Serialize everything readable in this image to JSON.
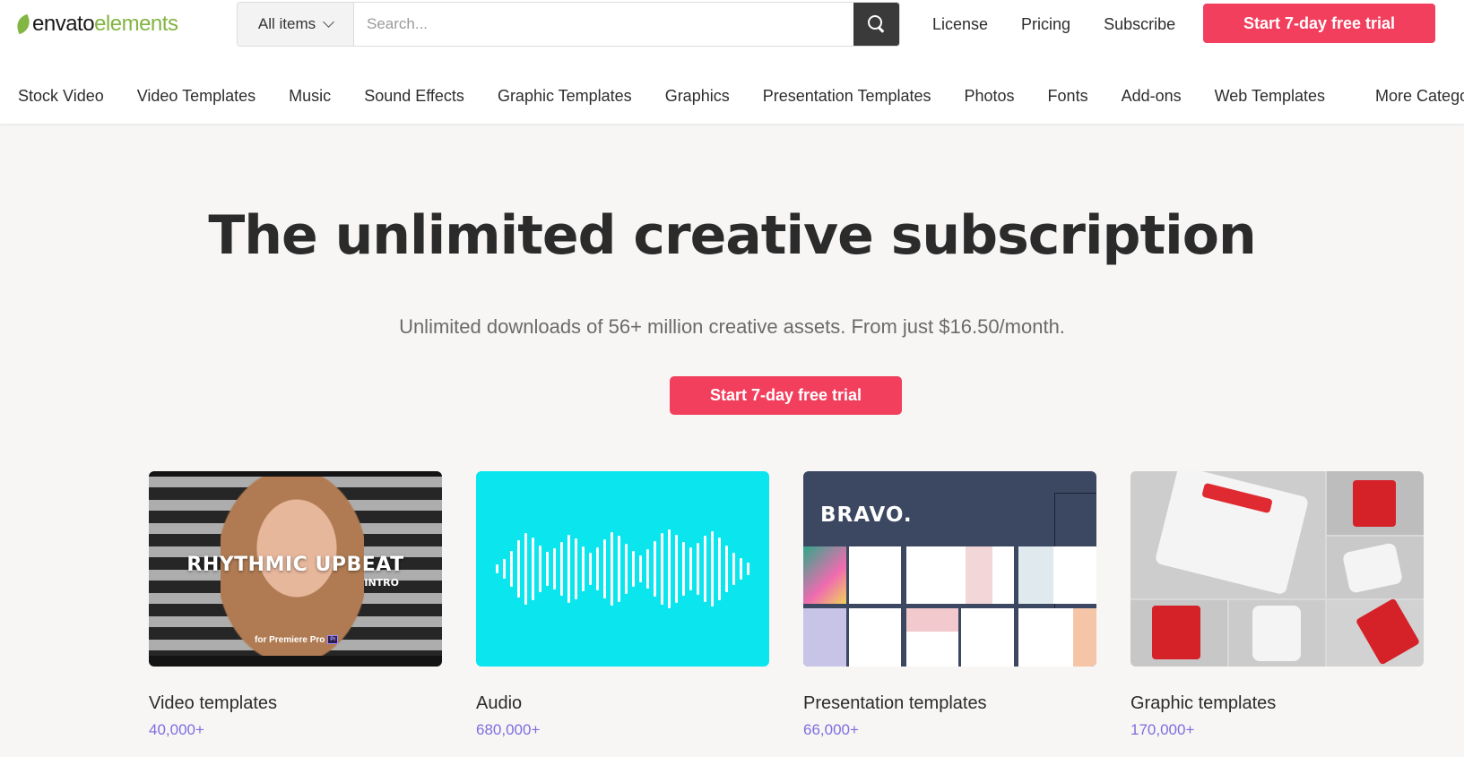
{
  "brand": {
    "part1": "envato",
    "part2": "elements"
  },
  "search": {
    "category": "All items",
    "placeholder": "Search..."
  },
  "header_links": [
    "License",
    "Pricing",
    "Subscribe"
  ],
  "header_cta": "Start 7-day free trial",
  "categories": [
    "Stock Video",
    "Video Templates",
    "Music",
    "Sound Effects",
    "Graphic Templates",
    "Graphics",
    "Presentation Templates",
    "Photos",
    "Fonts",
    "Add-ons",
    "Web Templates"
  ],
  "more_categories": "More Categori",
  "hero": {
    "title": "The unlimited creative subscription",
    "subtitle": "Unlimited downloads of 56+ million creative assets. From just $16.50/month.",
    "cta": "Start 7-day free trial"
  },
  "cards": [
    {
      "title": "Video templates",
      "count": "40,000+",
      "thumb_title": "RHYTHMIC UPBEAT",
      "thumb_sub": "INTRO",
      "thumb_note": "for Premiere Pro",
      "thumb_badge": "Pr"
    },
    {
      "title": "Audio",
      "count": "680,000+"
    },
    {
      "title": "Presentation templates",
      "count": "66,000+",
      "thumb_title": "BRAVO."
    },
    {
      "title": "Graphic templates",
      "count": "170,000+"
    }
  ],
  "colors": {
    "accent": "#f23f5d",
    "brand_green": "#82b541",
    "count": "#7e6ee0",
    "audio_bg": "#0be6ee"
  }
}
